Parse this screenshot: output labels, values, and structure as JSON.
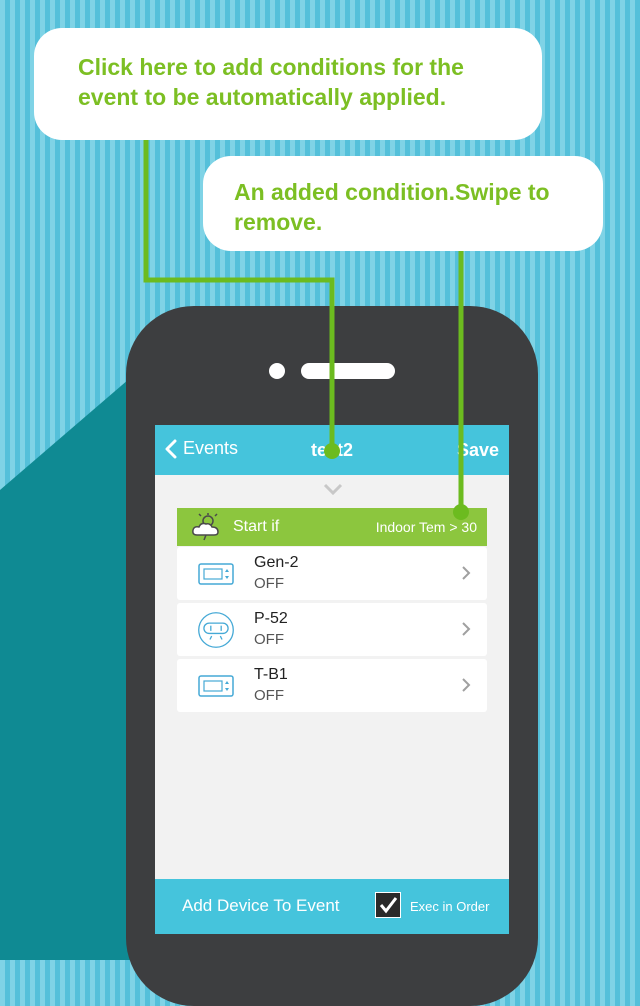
{
  "annotations": {
    "callout_add_conditions": "Click here to add conditions for the event to be automatically applied.",
    "callout_added_condition": "An added condition.Swipe to remove."
  },
  "navbar": {
    "back_label": "Events",
    "title": "test2",
    "save_label": "Save"
  },
  "condition": {
    "label": "Start if",
    "value": "Indoor Tem > 30",
    "icon": "weather-icon"
  },
  "devices": [
    {
      "name": "Gen-2",
      "state": "OFF",
      "icon": "thermostat-icon"
    },
    {
      "name": "P-52",
      "state": "OFF",
      "icon": "smart-plug-icon"
    },
    {
      "name": "T-B1",
      "state": "OFF",
      "icon": "thermostat-icon"
    }
  ],
  "bottom": {
    "add_label": "Add Device To Event",
    "exec_label": "Exec in Order",
    "exec_checked": true
  },
  "colors": {
    "accent": "#45c4dc",
    "condition_green": "#8cc63e",
    "callout_text": "#7cbf23",
    "phone_body": "#3d3e40"
  }
}
